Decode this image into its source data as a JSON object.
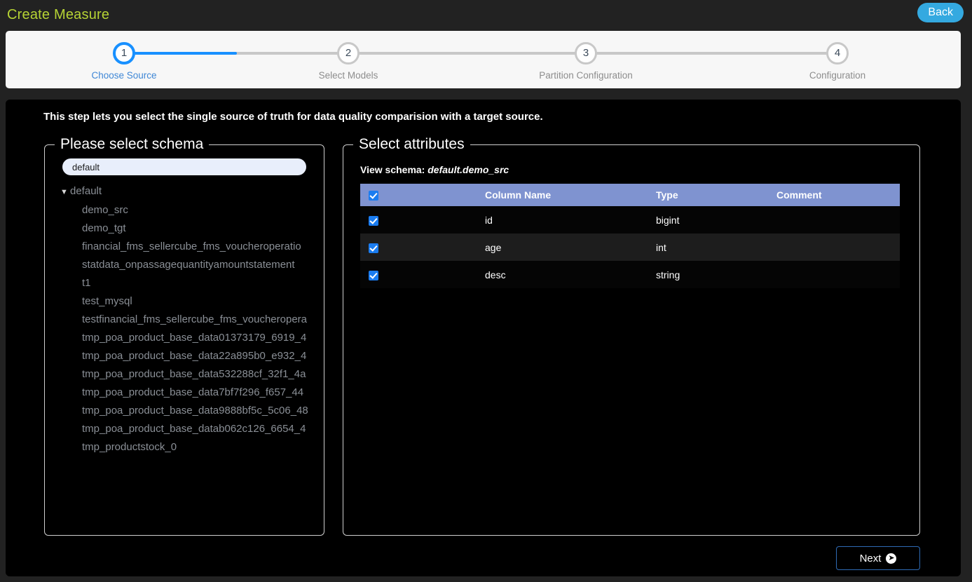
{
  "header": {
    "title": "Create Measure",
    "back_label": "Back"
  },
  "stepper": {
    "steps": [
      {
        "num": "1",
        "label": "Choose Source"
      },
      {
        "num": "2",
        "label": "Select Models"
      },
      {
        "num": "3",
        "label": "Partition Configuration"
      },
      {
        "num": "4",
        "label": "Configuration"
      }
    ],
    "active_index": 0,
    "active_color": "#1890ff",
    "inactive_color": "#c8c8c8"
  },
  "main": {
    "hint": "This step lets you select the single source of truth for data quality comparision with a target source.",
    "next_label": "Next",
    "next_icon": "arrow-right-circle-icon"
  },
  "schema_panel": {
    "legend": "Please select schema",
    "input_value": "default",
    "input_placeholder": "default",
    "tree": {
      "caret": "▼",
      "root": "default",
      "children": [
        "demo_src",
        "demo_tgt",
        "financial_fms_sellercube_fms_voucheroperatio",
        "statdata_onpassagequantityamountstatement",
        "t1",
        "test_mysql",
        "testfinancial_fms_sellercube_fms_voucheropera",
        "tmp_poa_product_base_data01373179_6919_4",
        "tmp_poa_product_base_data22a895b0_e932_4",
        "tmp_poa_product_base_data532288cf_32f1_4a",
        "tmp_poa_product_base_data7bf7f296_f657_44",
        "tmp_poa_product_base_data9888bf5c_5c06_48",
        "tmp_poa_product_base_datab062c126_6654_4",
        "tmp_productstock_0"
      ]
    }
  },
  "attributes_panel": {
    "legend": "Select attributes",
    "view_schema_label": "View schema:",
    "view_schema_value": "default.demo_src",
    "header_bg": "#7f93d0",
    "checkbox_color": "#1a7cf0",
    "columns": [
      "",
      "Column Name",
      "Type",
      "Comment"
    ],
    "select_all_checked": true,
    "rows": [
      {
        "checked": true,
        "name": "id",
        "type": "bigint",
        "comment": ""
      },
      {
        "checked": true,
        "name": "age",
        "type": "int",
        "comment": ""
      },
      {
        "checked": true,
        "name": "desc",
        "type": "string",
        "comment": ""
      }
    ]
  }
}
